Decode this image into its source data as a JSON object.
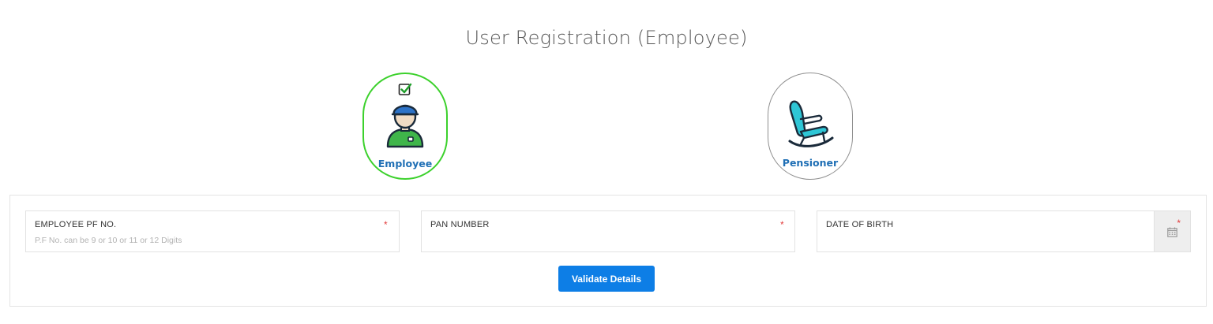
{
  "page": {
    "title": "User Registration (Employee)"
  },
  "user_types": {
    "employee": {
      "label": "Employee",
      "selected": true,
      "icon": "employee-avatar-icon"
    },
    "pensioner": {
      "label": "Pensioner",
      "selected": false,
      "icon": "rocking-chair-icon"
    }
  },
  "form": {
    "pf_no": {
      "label": "EMPLOYEE PF NO.",
      "hint": "P.F No. can be 9 or 10 or 11 or 12 Digits",
      "required": "*",
      "value": ""
    },
    "pan": {
      "label": "PAN NUMBER",
      "required": "*",
      "value": ""
    },
    "dob": {
      "label": "DATE OF BIRTH",
      "required": "*",
      "value": ""
    },
    "validate_label": "Validate Details"
  },
  "colors": {
    "selected_border": "#3cd12c",
    "unselected_border": "#8f8f8f",
    "label_blue": "#1f6fb5",
    "button_blue": "#0d7ee6",
    "required_red": "#e23b3b"
  }
}
